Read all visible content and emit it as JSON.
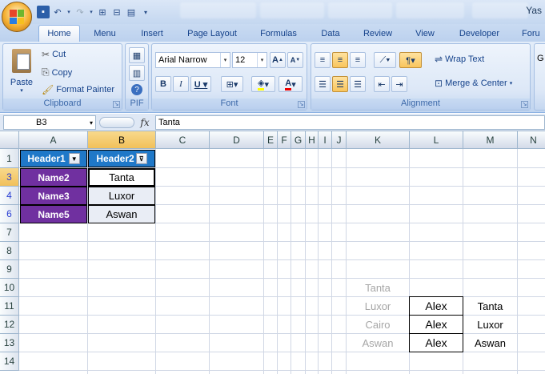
{
  "app": {
    "title_partial": "Yas"
  },
  "tabs": [
    "Home",
    "Menu",
    "Insert",
    "Page Layout",
    "Formulas",
    "Data",
    "Review",
    "View",
    "Developer",
    "Foru"
  ],
  "ribbon": {
    "clipboard": {
      "label": "Clipboard",
      "paste": "Paste",
      "cut": "Cut",
      "copy": "Copy",
      "format_painter": "Format Painter"
    },
    "pif": {
      "label": "PIF"
    },
    "font": {
      "label": "Font",
      "name": "Arial Narrow",
      "size": "12"
    },
    "alignment": {
      "label": "Alignment",
      "wrap": "Wrap Text",
      "merge": "Merge & Center"
    }
  },
  "formula_bar": {
    "name_box": "B3",
    "fx": "fx",
    "value": "Tanta"
  },
  "columns": [
    "A",
    "B",
    "C",
    "D",
    "E",
    "F",
    "G",
    "H",
    "I",
    "J",
    "K",
    "L",
    "M",
    "N"
  ],
  "rows": [
    "1",
    "3",
    "4",
    "6",
    "7",
    "8",
    "9",
    "10",
    "11",
    "12",
    "13",
    "14"
  ],
  "table": {
    "header1": "Header1",
    "header2": "Header2",
    "names": [
      "Name2",
      "Name3",
      "Name5"
    ],
    "values": [
      "Tanta",
      "Luxor",
      "Aswan"
    ]
  },
  "side": {
    "k": [
      "Tanta",
      "Luxor",
      "Cairo",
      "Aswan"
    ],
    "l": [
      "Alex",
      "Alex",
      "Alex"
    ],
    "m": [
      "Tanta",
      "Luxor",
      "Aswan"
    ]
  },
  "colors": {
    "header_fill": "#1f78c8",
    "name_fill": "#7030a0",
    "gray_text": "#a6a6a6"
  }
}
